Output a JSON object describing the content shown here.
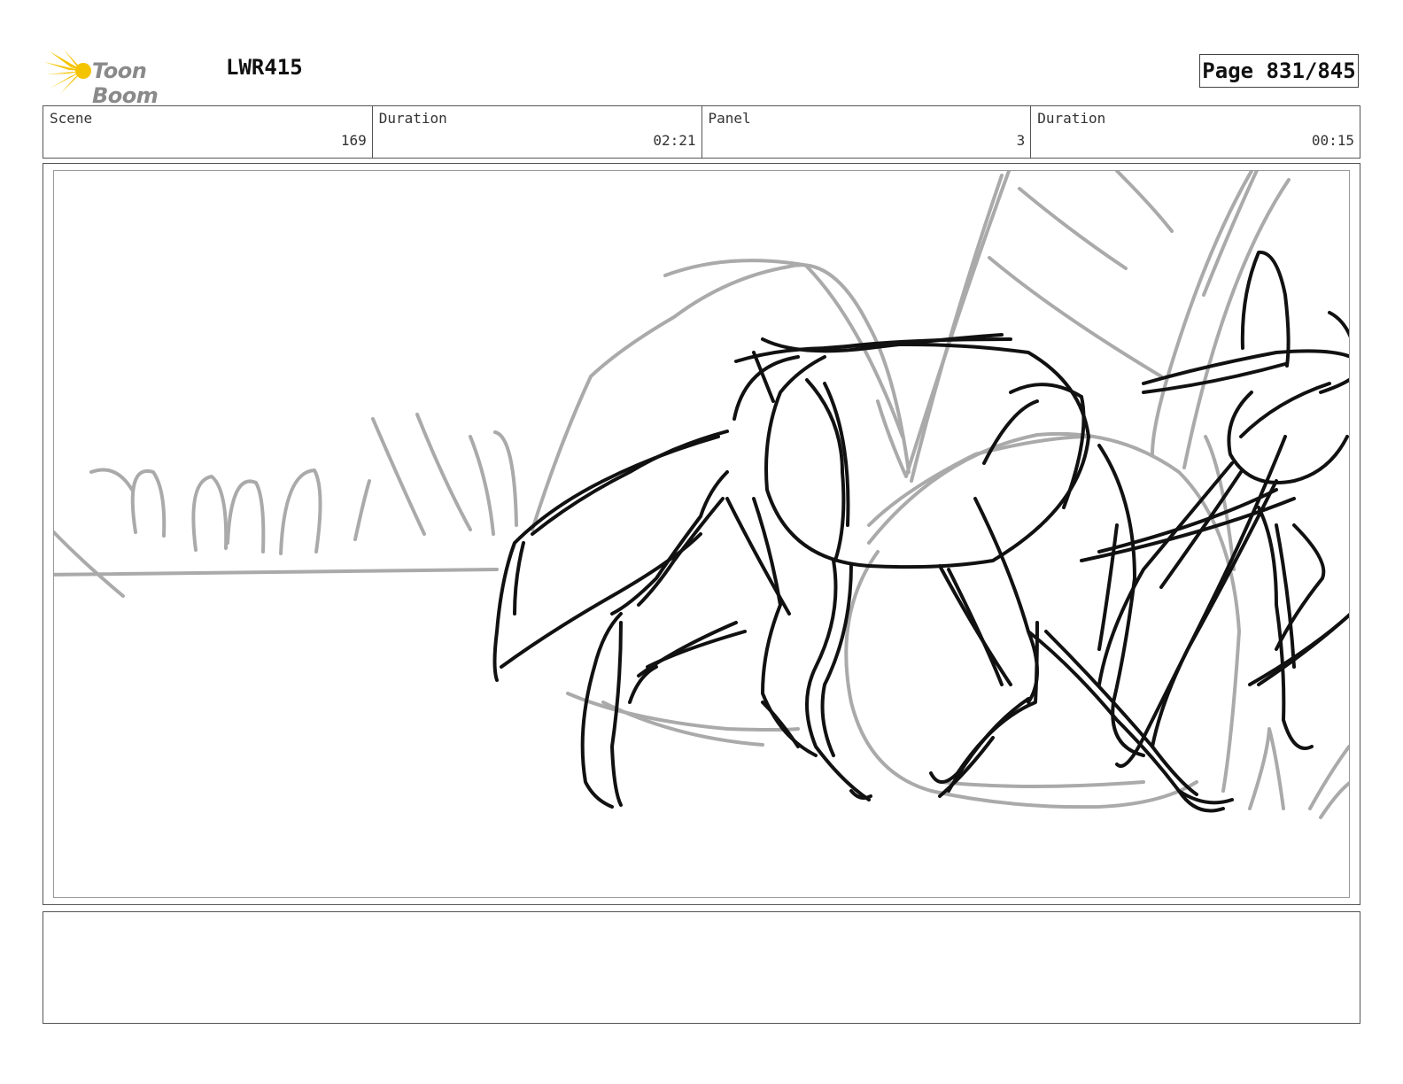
{
  "header": {
    "logo_text": "Toon Boom",
    "project_code": "LWR415",
    "page_label": "Page 831/845"
  },
  "info_bar": [
    {
      "label": "Scene",
      "value": "169"
    },
    {
      "label": "Duration",
      "value": "02:21"
    },
    {
      "label": "Panel",
      "value": "3"
    },
    {
      "label": "Duration",
      "value": "00:15"
    }
  ],
  "colors": {
    "sketch_dark": "#111111",
    "sketch_light": "#aaaaaa",
    "logo_yellow": "#f5c400",
    "logo_text": "#8a8a8a"
  },
  "notes": {
    "text": ""
  }
}
